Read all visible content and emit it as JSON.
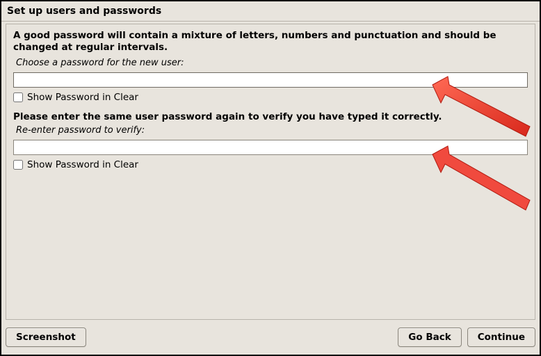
{
  "title": "Set up users and passwords",
  "intro": "A good password will contain a mixture of letters, numbers and punctuation and should be changed at regular intervals.",
  "prompt1": "Choose a password for the new user:",
  "password1_value": "",
  "show1_label": "Show Password in Clear",
  "show1_checked": false,
  "verify_heading": "Please enter the same user password again to verify you have typed it correctly.",
  "prompt2": "Re-enter password to verify:",
  "password2_value": "",
  "show2_label": "Show Password in Clear",
  "show2_checked": false,
  "buttons": {
    "screenshot": "Screenshot",
    "go_back": "Go Back",
    "continue": "Continue"
  },
  "colors": {
    "arrow": "#f04a3e"
  }
}
